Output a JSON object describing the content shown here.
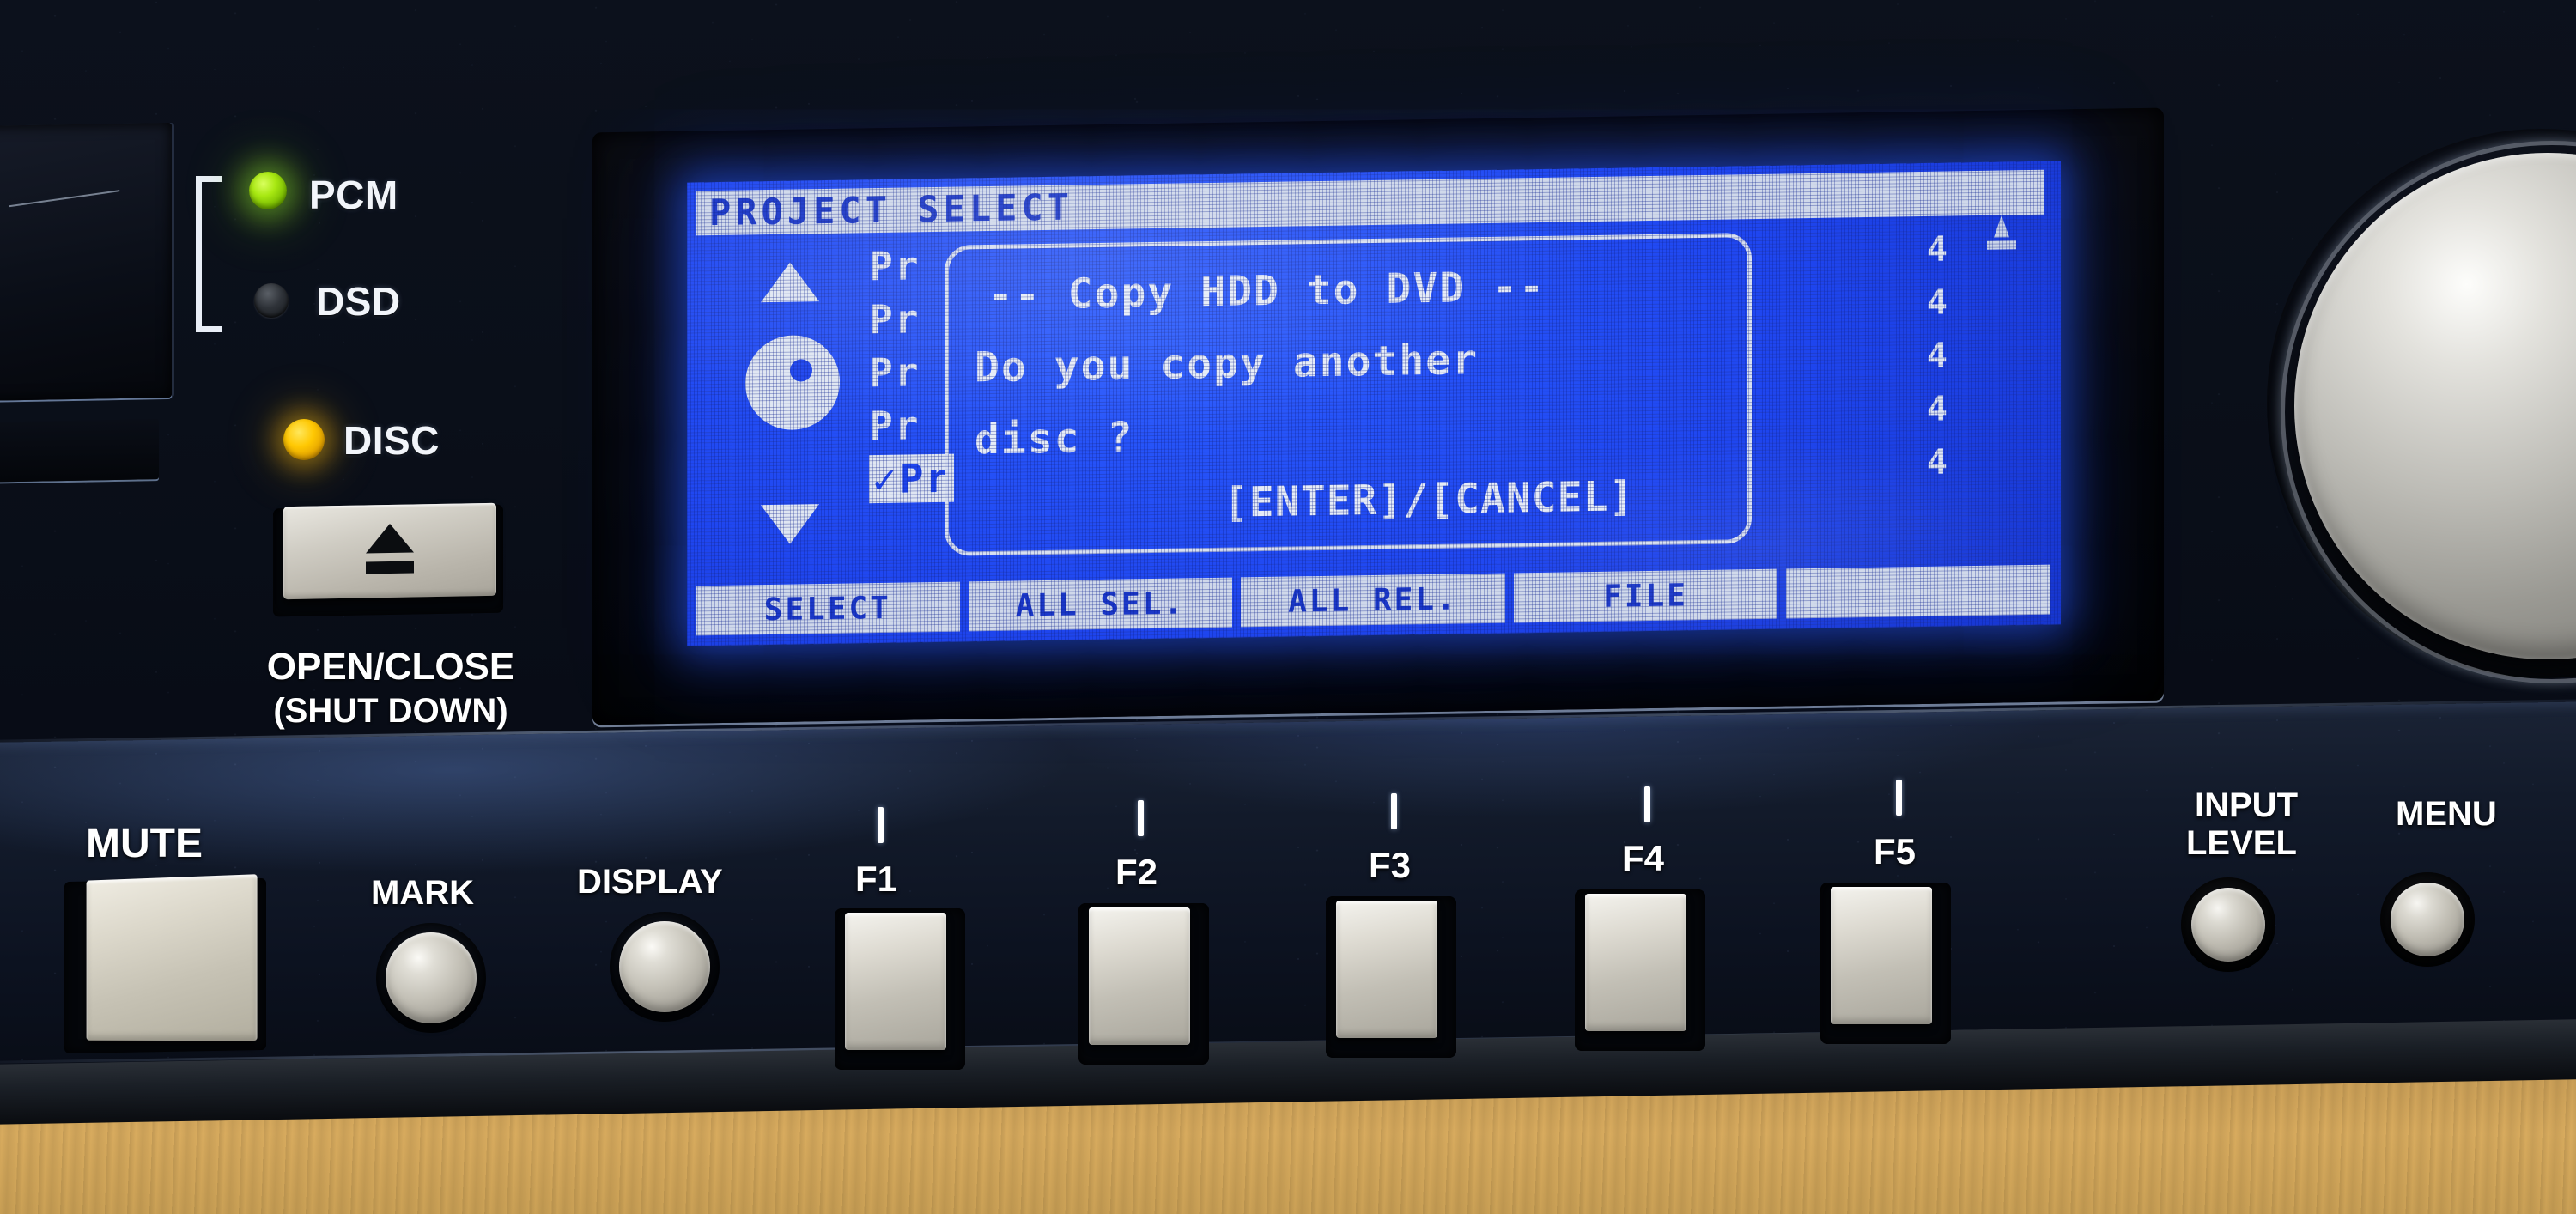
{
  "device": {
    "panel_finish_color": "#0c1220",
    "accent_glow_color": "#2b5cff"
  },
  "indicators": [
    {
      "label": "PCM",
      "state": "on",
      "color": "#9de018",
      "icon": "led-indicator"
    },
    {
      "label": "DSD",
      "state": "off",
      "color": "#2e3238",
      "icon": "led-indicator"
    },
    {
      "label": "DISC",
      "state": "on",
      "color": "#ffc803",
      "icon": "led-indicator"
    }
  ],
  "eject": {
    "icon": "eject-icon",
    "line1": "OPEN/CLOSE",
    "line2": "(SHUT DOWN)"
  },
  "lcd": {
    "title": "PROJECT SELECT",
    "nav": {
      "up_icon": "triangle-up-icon",
      "disc_icon": "disc-icon",
      "down_icon": "triangle-down-icon"
    },
    "hdd_icon": "hdd-icon",
    "project_rows": [
      {
        "label": "Pr",
        "number": "4",
        "selected": false,
        "checked": false
      },
      {
        "label": "Pr",
        "number": "4",
        "selected": false,
        "checked": false
      },
      {
        "label": "Pr",
        "number": "4",
        "selected": false,
        "checked": false
      },
      {
        "label": "Pr",
        "number": "4",
        "selected": false,
        "checked": false
      },
      {
        "label": "Pr",
        "number": "4",
        "selected": true,
        "checked": true
      }
    ],
    "check_glyph": "✓",
    "dialog": {
      "line1": "-- Copy HDD to DVD --",
      "line2": "Do you copy another",
      "line3": "disc ?",
      "line4": "[ENTER]/[CANCEL]"
    },
    "function_bar": [
      {
        "label": "SELECT"
      },
      {
        "label": "ALL SEL."
      },
      {
        "label": "ALL REL."
      },
      {
        "label": "FILE"
      },
      {
        "label": ""
      }
    ]
  },
  "controls": {
    "mute": {
      "label": "MUTE"
    },
    "mark": {
      "label": "MARK"
    },
    "display": {
      "label": "DISPLAY"
    },
    "function_keys": [
      {
        "label": "F1"
      },
      {
        "label": "F2"
      },
      {
        "label": "F3"
      },
      {
        "label": "F4"
      },
      {
        "label": "F5"
      }
    ],
    "input_level": {
      "line1": "INPUT",
      "line2": "LEVEL"
    },
    "menu": {
      "label": "MENU"
    },
    "jog_wheel": {
      "name": "jog-shuttle-wheel"
    }
  }
}
